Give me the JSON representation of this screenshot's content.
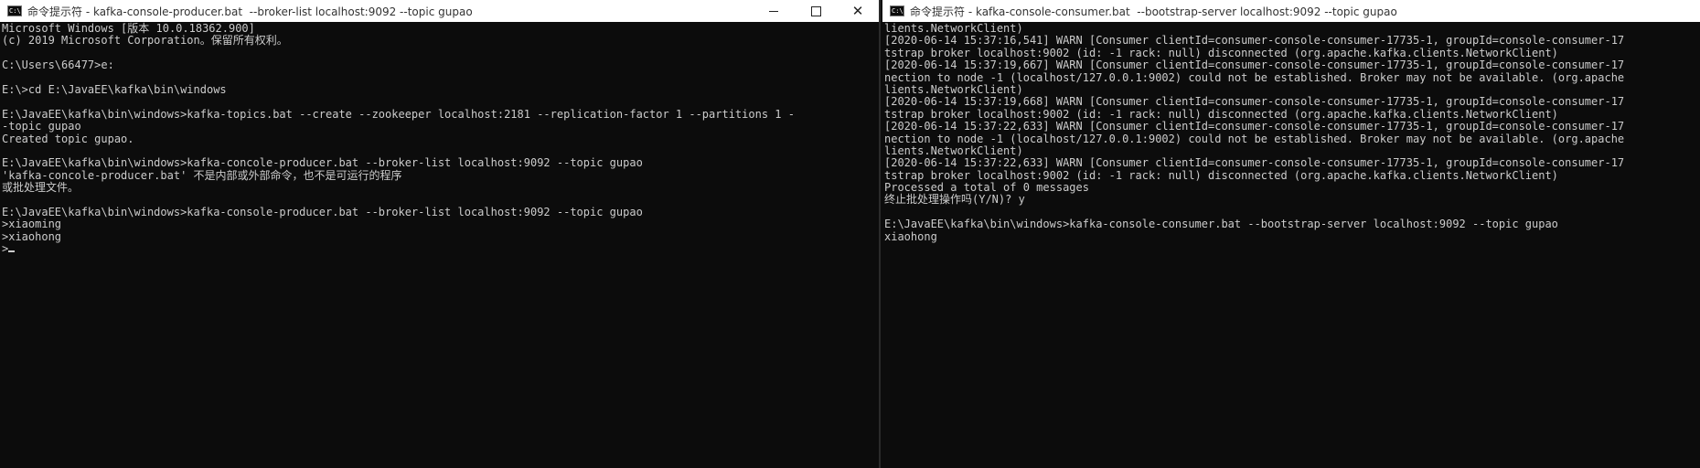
{
  "left_window": {
    "title": "命令提示符 - kafka-console-producer.bat  --broker-list localhost:9092 --topic gupao",
    "icon": "cmd-icon",
    "controls": {
      "minimize": "minimize-icon",
      "maximize": "maximize-icon",
      "close": "close-icon"
    },
    "lines": [
      "Microsoft Windows [版本 10.0.18362.900]",
      "(c) 2019 Microsoft Corporation。保留所有权利。",
      "",
      "C:\\Users\\66477>e:",
      "",
      "E:\\>cd E:\\JavaEE\\kafka\\bin\\windows",
      "",
      "E:\\JavaEE\\kafka\\bin\\windows>kafka-topics.bat --create --zookeeper localhost:2181 --replication-factor 1 --partitions 1 -",
      "-topic gupao",
      "Created topic gupao.",
      "",
      "E:\\JavaEE\\kafka\\bin\\windows>kafka-concole-producer.bat --broker-list localhost:9092 --topic gupao",
      "'kafka-concole-producer.bat' 不是内部或外部命令，也不是可运行的程序",
      "或批处理文件。",
      "",
      "E:\\JavaEE\\kafka\\bin\\windows>kafka-console-producer.bat --broker-list localhost:9092 --topic gupao",
      ">xiaoming",
      ">xiaohong",
      ">"
    ]
  },
  "right_window": {
    "title": "命令提示符 - kafka-console-consumer.bat  --bootstrap-server localhost:9092 --topic gupao",
    "icon": "cmd-icon",
    "lines": [
      "lients.NetworkClient)",
      "[2020-06-14 15:37:16,541] WARN [Consumer clientId=consumer-console-consumer-17735-1, groupId=console-consumer-17",
      "tstrap broker localhost:9002 (id: -1 rack: null) disconnected (org.apache.kafka.clients.NetworkClient)",
      "[2020-06-14 15:37:19,667] WARN [Consumer clientId=consumer-console-consumer-17735-1, groupId=console-consumer-17",
      "nection to node -1 (localhost/127.0.0.1:9002) could not be established. Broker may not be available. (org.apache",
      "lients.NetworkClient)",
      "[2020-06-14 15:37:19,668] WARN [Consumer clientId=consumer-console-consumer-17735-1, groupId=console-consumer-17",
      "tstrap broker localhost:9002 (id: -1 rack: null) disconnected (org.apache.kafka.clients.NetworkClient)",
      "[2020-06-14 15:37:22,633] WARN [Consumer clientId=consumer-console-consumer-17735-1, groupId=console-consumer-17",
      "nection to node -1 (localhost/127.0.0.1:9002) could not be established. Broker may not be available. (org.apache",
      "lients.NetworkClient)",
      "[2020-06-14 15:37:22,633] WARN [Consumer clientId=consumer-console-consumer-17735-1, groupId=console-consumer-17",
      "tstrap broker localhost:9002 (id: -1 rack: null) disconnected (org.apache.kafka.clients.NetworkClient)",
      "Processed a total of 0 messages",
      "终止批处理操作吗(Y/N)? y",
      "",
      "E:\\JavaEE\\kafka\\bin\\windows>kafka-console-consumer.bat --bootstrap-server localhost:9092 --topic gupao",
      "xiaohong"
    ]
  },
  "colors": {
    "console_bg": "#0c0c0c",
    "console_fg": "#cccccc",
    "titlebar_bg": "#ffffff"
  }
}
